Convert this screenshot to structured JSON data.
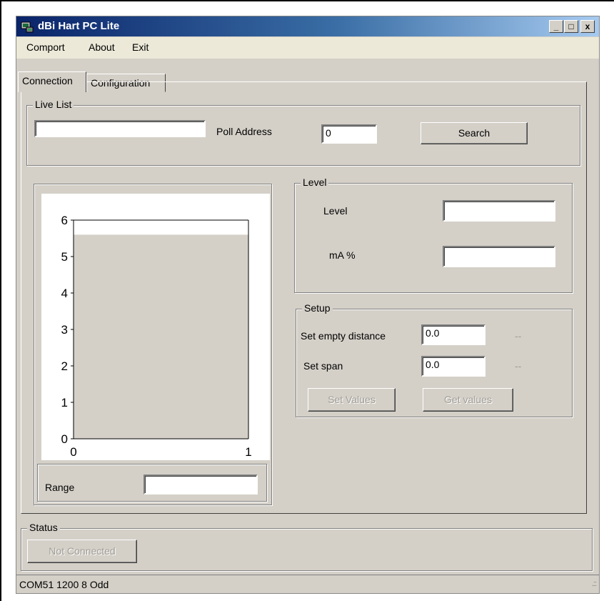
{
  "window": {
    "title": "dBi Hart PC Lite",
    "controls": {
      "minimize": "_",
      "maximize": "□",
      "close": "x"
    }
  },
  "menu": [
    "Comport",
    "About",
    "Exit"
  ],
  "tabs": [
    {
      "label": "Connection",
      "active": true
    },
    {
      "label": "Configuration",
      "active": false
    }
  ],
  "live_list": {
    "title": "Live List",
    "list_value": "",
    "poll_address_label": "Poll Address",
    "poll_address_value": "0",
    "search_label": "Search"
  },
  "level_group": {
    "title": "Level",
    "level_label": "Level",
    "level_value": "",
    "ma_label": "mA %",
    "ma_value": ""
  },
  "setup_group": {
    "title": "Setup",
    "empty_label": "Set empty distance",
    "empty_value": "0.0",
    "empty_unit": "--",
    "span_label": "Set span",
    "span_value": "0.0",
    "span_unit": "--",
    "set_values_label": "Set Values",
    "get_values_label": "Get values"
  },
  "chart_data": {
    "type": "bar",
    "x_ticks": [
      "0",
      "1"
    ],
    "y_ticks": [
      "0",
      "1",
      "2",
      "3",
      "4",
      "5",
      "6"
    ],
    "ylim": [
      0,
      6
    ],
    "xlim": [
      0,
      1
    ],
    "values": [
      5.6
    ],
    "colors": {
      "bar": "#d4d0c8",
      "frame": "#000000"
    }
  },
  "range": {
    "label": "Range",
    "value": ""
  },
  "status": {
    "title": "Status",
    "button_label": "Not Connected",
    "statusbar_text": "COM51 1200 8 Odd",
    "grip": ".::"
  }
}
